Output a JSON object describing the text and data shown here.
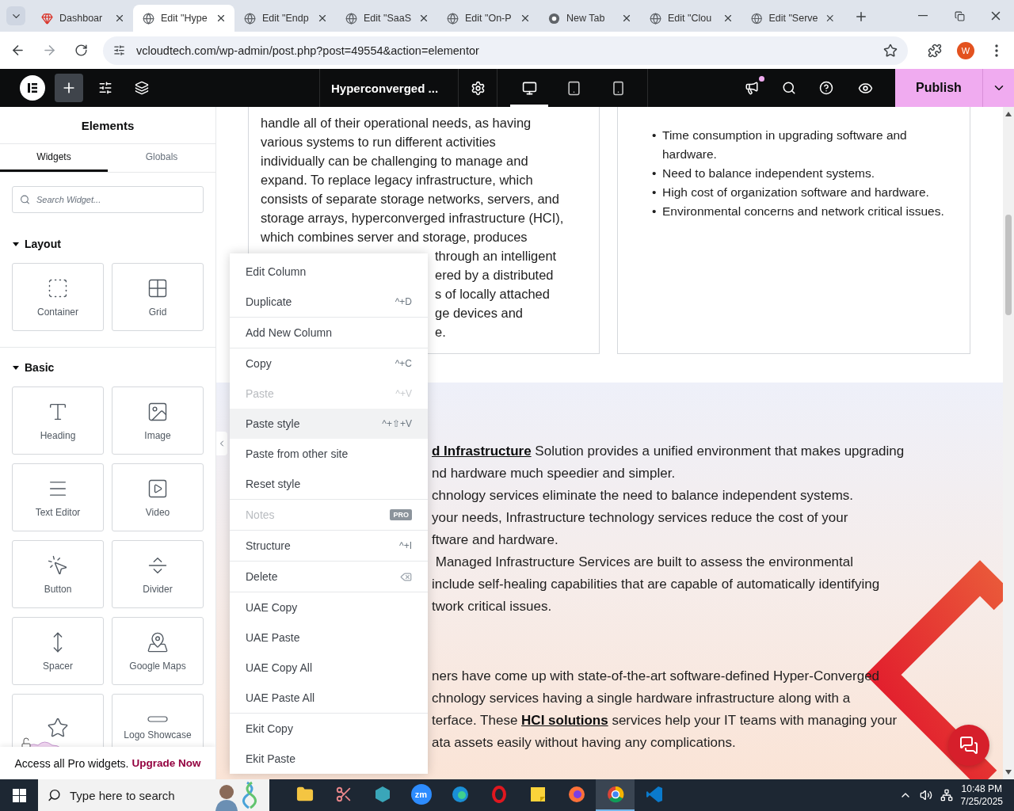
{
  "browser": {
    "tabs": [
      {
        "title": "Dashboar",
        "selected": false
      },
      {
        "title": "Edit \"Hype",
        "selected": true
      },
      {
        "title": "Edit \"Endp",
        "selected": false
      },
      {
        "title": "Edit \"SaaS",
        "selected": false
      },
      {
        "title": "Edit \"On-P",
        "selected": false
      },
      {
        "title": "New Tab",
        "selected": false
      },
      {
        "title": "Edit \"Clou",
        "selected": false
      },
      {
        "title": "Edit \"Serve",
        "selected": false
      }
    ],
    "url": "vcloudtech.com/wp-admin/post.php?post=49554&action=elementor",
    "profile": "W"
  },
  "editor_bar": {
    "document_title": "Hyperconverged ...",
    "add_active": true,
    "devices": [
      {
        "selected": true
      },
      {
        "selected": false
      },
      {
        "selected": false
      }
    ],
    "notification": true,
    "publish": "Publish"
  },
  "panel": {
    "title": "Elements",
    "tabs": [
      {
        "label": "Widgets",
        "selected": true
      },
      {
        "label": "Globals",
        "selected": false
      }
    ],
    "search": {
      "placeholder": "Search Widget..."
    },
    "sections": [
      {
        "title": "Layout",
        "expanded": true,
        "widgets": [
          {
            "label": "Container",
            "pro": false
          },
          {
            "label": "Grid",
            "pro": false
          }
        ]
      },
      {
        "title": "Basic",
        "expanded": true,
        "widgets": [
          {
            "label": "Heading",
            "pro": false
          },
          {
            "label": "Image",
            "pro": false
          },
          {
            "label": "Text Editor",
            "pro": false
          },
          {
            "label": "Video",
            "pro": false
          },
          {
            "label": "Button",
            "pro": false
          },
          {
            "label": "Divider",
            "pro": false
          },
          {
            "label": "Spacer",
            "pro": false
          },
          {
            "label": "Google Maps",
            "pro": false
          },
          {
            "pro": true
          },
          {
            "label": "Logo Showcase",
            "pro": false
          }
        ]
      }
    ],
    "promo": {
      "text": "Access all Pro widgets.",
      "link": "Upgrade Now"
    }
  },
  "canvas": {
    "left_card": [
      {
        "text": "handle all of their operational needs, as having",
        "partial": false
      },
      {
        "text": "various systems to run different activities",
        "partial": false
      },
      {
        "text": "individually can be challenging to manage and",
        "partial": false
      },
      {
        "text": "expand. To replace legacy infrastructure, which",
        "partial": false
      },
      {
        "text": "consists of separate storage networks, servers, and",
        "partial": false
      },
      {
        "text": "storage arrays, hyperconverged infrastructure (HCI),",
        "partial": false
      },
      {
        "text": "which combines server and storage, produces",
        "partial": false
      },
      {
        "text": "through an intelligent",
        "partial": true
      },
      {
        "text": "ered by a distributed",
        "partial": true
      },
      {
        "text": "s of locally attached",
        "partial": true
      },
      {
        "text": "ge devices and",
        "partial": true
      },
      {
        "text": "e.",
        "partial": true
      }
    ],
    "right_card_bullets": [
      {
        "marker": "•",
        "text": "Time consumption in upgrading software and hardware."
      },
      {
        "marker": "•",
        "text": "Need to balance independent systems."
      },
      {
        "marker": "•",
        "text": "High cost of organization software and hardware."
      },
      {
        "marker": "•",
        "text": "Environmental concerns and network critical issues."
      }
    ],
    "section_paragraphs": [
      [
        [
          {
            "text": "d Infrastructure",
            "kind": "link"
          },
          {
            "text": " Solution provides a unified environment that makes upgrading",
            "kind": "plain"
          }
        ],
        [
          {
            "text": "nd hardware much speedier and simpler.",
            "kind": "plain"
          }
        ],
        [
          {
            "text": "chnology services eliminate the need to balance independent systems.",
            "kind": "plain"
          }
        ],
        [
          {
            "text": "your needs, Infrastructure technology services reduce the cost of your",
            "kind": "plain"
          }
        ],
        [
          {
            "text": "ftware and hardware.",
            "kind": "plain"
          }
        ],
        [
          {
            "text": " Managed Infrastructure Services are built to assess the environmental",
            "kind": "plain"
          }
        ],
        [
          {
            "text": "include self-healing capabilities that are capable of automatically identifying",
            "kind": "plain"
          }
        ],
        [
          {
            "text": "twork critical issues.",
            "kind": "plain"
          }
        ]
      ],
      [
        [
          {
            "text": "ners have come up with state-of-the-art software-defined Hyper-Converged",
            "kind": "plain"
          }
        ],
        [
          {
            "text": "chnology services having a single hardware infrastructure along with a",
            "kind": "plain"
          }
        ],
        [
          {
            "text": "terface. These ",
            "kind": "plain"
          },
          {
            "text": "HCI solutions",
            "kind": "link"
          },
          {
            "text": " services help your IT teams with managing your",
            "kind": "plain"
          }
        ],
        [
          {
            "text": "ata assets easily without having any complications.",
            "kind": "plain"
          }
        ]
      ]
    ]
  },
  "context_menu": [
    [
      {
        "label": "Edit Column",
        "kind": "plain",
        "disabled": false,
        "highlighted": false
      },
      {
        "label": "Duplicate",
        "kind": "shortcut",
        "shortcut": "^+D",
        "disabled": false,
        "highlighted": false
      }
    ],
    [
      {
        "label": "Add New Column",
        "kind": "plain",
        "disabled": false,
        "highlighted": false
      }
    ],
    [
      {
        "label": "Copy",
        "kind": "shortcut",
        "shortcut": "^+C",
        "disabled": false,
        "highlighted": false
      },
      {
        "label": "Paste",
        "kind": "shortcut",
        "shortcut": "^+V",
        "disabled": true,
        "highlighted": false
      },
      {
        "label": "Paste style",
        "kind": "shortcut",
        "shortcut": "^+⇧+V",
        "disabled": false,
        "highlighted": true
      },
      {
        "label": "Paste from other site",
        "kind": "plain",
        "disabled": false,
        "highlighted": false
      },
      {
        "label": "Reset style",
        "kind": "plain",
        "disabled": false,
        "highlighted": false
      }
    ],
    [
      {
        "label": "Notes",
        "kind": "badge",
        "badge": "PRO",
        "disabled": true,
        "highlighted": false
      }
    ],
    [
      {
        "label": "Structure",
        "kind": "shortcut",
        "shortcut": "^+I",
        "disabled": false,
        "highlighted": false
      }
    ],
    [
      {
        "label": "Delete",
        "kind": "key-icon",
        "disabled": false,
        "highlighted": false
      }
    ],
    [
      {
        "label": "UAE Copy",
        "kind": "plain",
        "disabled": false,
        "highlighted": false
      },
      {
        "label": "UAE Paste",
        "kind": "plain",
        "disabled": false,
        "highlighted": false
      },
      {
        "label": "UAE Copy All",
        "kind": "plain",
        "disabled": false,
        "highlighted": false
      },
      {
        "label": "UAE Paste All",
        "kind": "plain",
        "disabled": false,
        "highlighted": false
      }
    ],
    [
      {
        "label": "Ekit Copy",
        "kind": "plain",
        "disabled": false,
        "highlighted": false
      },
      {
        "label": "Ekit Paste",
        "kind": "plain",
        "disabled": false,
        "highlighted": false
      }
    ]
  ],
  "taskbar": {
    "search": {
      "placeholder": "Type here to search"
    },
    "apps": [
      {
        "active": false
      },
      {
        "active": false
      },
      {
        "active": false
      },
      {
        "label": "zm",
        "active": false
      },
      {
        "active": false
      },
      {
        "active": false
      },
      {
        "active": false
      },
      {
        "active": false
      },
      {
        "active": true
      },
      {
        "active": false
      }
    ],
    "time": "10:48 PM",
    "date": "7/25/2025"
  }
}
